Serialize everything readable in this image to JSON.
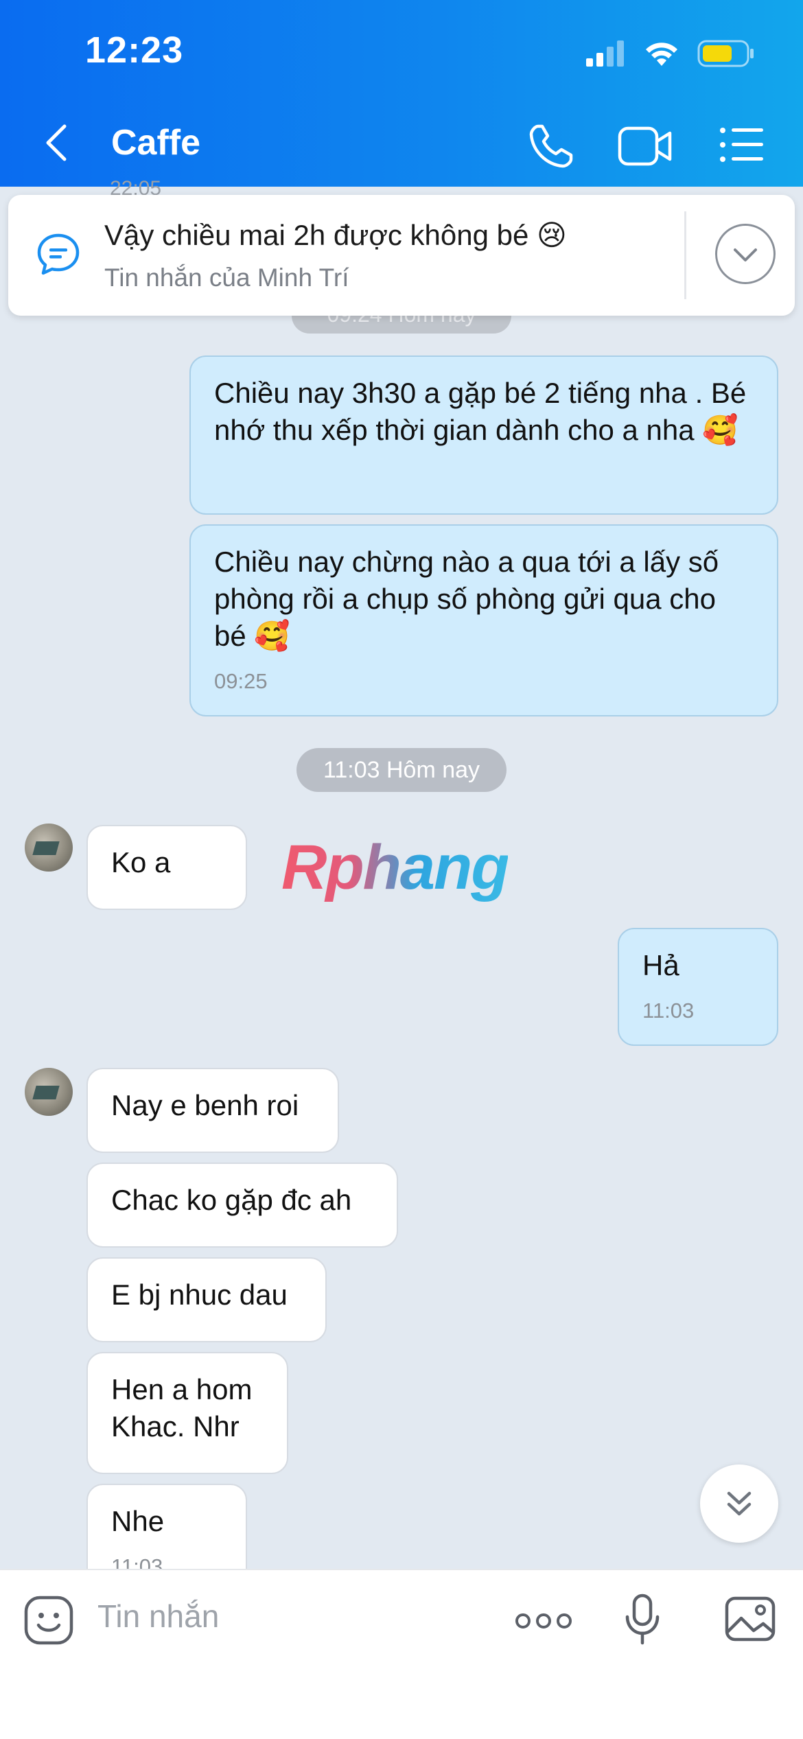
{
  "status_bar": {
    "time": "12:23"
  },
  "header": {
    "title": "Caffe"
  },
  "pinned": {
    "text": "Vậy chiều mai 2h được không bé",
    "emoji": "😢",
    "subtitle": "Tin nhắn của Minh Trí"
  },
  "partial": {
    "top_time": "22:05",
    "top_pill": "09:24 Hôm nay"
  },
  "messages": {
    "out1": {
      "text": "Chiều nay 3h30 a gặp bé 2 tiếng nha . Bé nhớ thu xếp thời gian dành cho a nha",
      "emoji": "🥰"
    },
    "out2": {
      "text": "Chiều nay chừng nào a qua tới a lấy số phòng rồi a chụp số phòng gửi qua cho bé",
      "emoji": "🥰",
      "time": "09:25"
    },
    "separator": "11:03 Hôm nay",
    "in1": {
      "text": "Ko a"
    },
    "out3": {
      "text": "Hả",
      "time": "11:03"
    },
    "in2": {
      "text": "Nay e benh roi"
    },
    "in3": {
      "text": "Chac ko gặp đc ah"
    },
    "in4": {
      "text": "E bj nhuc dau"
    },
    "in5": {
      "text": "Hen a hom Khac. Nhr"
    },
    "in6": {
      "text": "Nhe",
      "time": "11:03"
    }
  },
  "watermark": "Rphang",
  "input": {
    "placeholder": "Tin nhắn"
  },
  "icons": {
    "back": "chevron-left-icon",
    "call": "phone-icon",
    "video": "video-camera-icon",
    "menu": "list-menu-icon",
    "pinned": "message-bubble-icon",
    "expand": "chevron-down-icon",
    "scroll": "double-chevron-down-icon",
    "sticker": "sticker-face-icon",
    "more": "more-dots-icon",
    "mic": "microphone-icon",
    "image": "image-icon"
  },
  "colors": {
    "header_start": "#0a6cf0",
    "header_end": "#12a6ec",
    "outgoing_bubble": "#d0ecfd",
    "incoming_bubble": "#ffffff",
    "chat_bg": "#e2e9f1",
    "battery": "#f5d90a"
  }
}
